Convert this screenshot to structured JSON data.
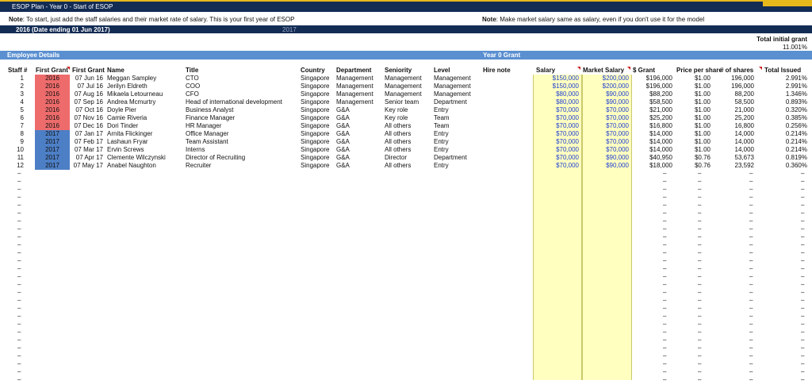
{
  "window": {
    "title": "ESOP Plan - Year 0 - Start of ESOP"
  },
  "notes": {
    "left_label": "Note",
    "left_text": ": To start, just add the staff salaries and their market rate of salary. This is your first year of ESOP",
    "right_label": "Note",
    "right_text": ": Make market salary same as salary, even if you don't use it for the model"
  },
  "year_bar": {
    "current": "2016 (Date ending 01 Jun 2017)",
    "next": "2017"
  },
  "summary": {
    "label": "Total initial grant",
    "value": "11.001%"
  },
  "section_bar": {
    "left": "Employee Details",
    "right": "Year 0 Grant"
  },
  "columns": [
    "Staff #",
    "First Grant",
    "First Grant",
    "Name",
    "Title",
    "Country",
    "Department",
    "Seniority",
    "Level",
    "Hire note",
    "Salary",
    "Market Salary",
    "$ Grant",
    "Price per share",
    "# of shares",
    "Total Issued"
  ],
  "rows": [
    {
      "n": "1",
      "year": "2016",
      "date": "07 Jun 16",
      "name": "Meggan Sampley",
      "title": "CTO",
      "country": "Singapore",
      "dept": "Management",
      "seniority": "Management",
      "level": "Management",
      "salary": "$150,000",
      "market": "$200,000",
      "grant": "$196,000",
      "price": "$1.00",
      "shares": "196,000",
      "issued": "2.991%"
    },
    {
      "n": "2",
      "year": "2016",
      "date": "07 Jul 16",
      "name": "Jerilyn Eldreth",
      "title": "COO",
      "country": "Singapore",
      "dept": "Management",
      "seniority": "Management",
      "level": "Management",
      "salary": "$150,000",
      "market": "$200,000",
      "grant": "$196,000",
      "price": "$1.00",
      "shares": "196,000",
      "issued": "2.991%"
    },
    {
      "n": "3",
      "year": "2016",
      "date": "07 Aug 16",
      "name": "Mikaela Letourneau",
      "title": "CFO",
      "country": "Singapore",
      "dept": "Management",
      "seniority": "Management",
      "level": "Management",
      "salary": "$80,000",
      "market": "$90,000",
      "grant": "$88,200",
      "price": "$1.00",
      "shares": "88,200",
      "issued": "1.346%"
    },
    {
      "n": "4",
      "year": "2016",
      "date": "07 Sep 16",
      "name": "Andrea Mcmurtry",
      "title": "Head of international development",
      "country": "Singapore",
      "dept": "Management",
      "seniority": "Senior team",
      "level": "Department",
      "salary": "$80,000",
      "market": "$90,000",
      "grant": "$58,500",
      "price": "$1.00",
      "shares": "58,500",
      "issued": "0.893%"
    },
    {
      "n": "5",
      "year": "2016",
      "date": "07 Oct 16",
      "name": "Doyle Pier",
      "title": "Business Analyst",
      "country": "Singapore",
      "dept": "G&A",
      "seniority": "Key role",
      "level": "Entry",
      "salary": "$70,000",
      "market": "$70,000",
      "grant": "$21,000",
      "price": "$1.00",
      "shares": "21,000",
      "issued": "0.320%"
    },
    {
      "n": "6",
      "year": "2016",
      "date": "07 Nov 16",
      "name": "Camie Riveria",
      "title": "Finance Manager",
      "country": "Singapore",
      "dept": "G&A",
      "seniority": "Key role",
      "level": "Team",
      "salary": "$70,000",
      "market": "$70,000",
      "grant": "$25,200",
      "price": "$1.00",
      "shares": "25,200",
      "issued": "0.385%"
    },
    {
      "n": "7",
      "year": "2016",
      "date": "07 Dec 16",
      "name": "Dori Tinder",
      "title": "HR Manager",
      "country": "Singapore",
      "dept": "G&A",
      "seniority": "All others",
      "level": "Team",
      "salary": "$70,000",
      "market": "$70,000",
      "grant": "$16,800",
      "price": "$1.00",
      "shares": "16,800",
      "issued": "0.256%"
    },
    {
      "n": "8",
      "year": "2017",
      "date": "07 Jan 17",
      "name": "Arnita Flickinger",
      "title": "Office Manager",
      "country": "Singapore",
      "dept": "G&A",
      "seniority": "All others",
      "level": "Entry",
      "salary": "$70,000",
      "market": "$70,000",
      "grant": "$14,000",
      "price": "$1.00",
      "shares": "14,000",
      "issued": "0.214%"
    },
    {
      "n": "9",
      "year": "2017",
      "date": "07 Feb 17",
      "name": "Lashaun Fryar",
      "title": "Team Assistant",
      "country": "Singapore",
      "dept": "G&A",
      "seniority": "All others",
      "level": "Entry",
      "salary": "$70,000",
      "market": "$70,000",
      "grant": "$14,000",
      "price": "$1.00",
      "shares": "14,000",
      "issued": "0.214%"
    },
    {
      "n": "10",
      "year": "2017",
      "date": "07 Mar 17",
      "name": "Ervin Screws",
      "title": "Interns",
      "country": "Singapore",
      "dept": "G&A",
      "seniority": "All others",
      "level": "Entry",
      "salary": "$70,000",
      "market": "$70,000",
      "grant": "$14,000",
      "price": "$1.00",
      "shares": "14,000",
      "issued": "0.214%"
    },
    {
      "n": "11",
      "year": "2017",
      "date": "07 Apr 17",
      "name": "Clemente Wilczynski",
      "title": "Director of Recruiting",
      "country": "Singapore",
      "dept": "G&A",
      "seniority": "Director",
      "level": "Department",
      "salary": "$70,000",
      "market": "$90,000",
      "grant": "$40,950",
      "price": "$0.76",
      "shares": "53,673",
      "issued": "0.819%"
    },
    {
      "n": "12",
      "year": "2017",
      "date": "07 May 17",
      "name": "Anabel Naughton",
      "title": "Recruiter",
      "country": "Singapore",
      "dept": "G&A",
      "seniority": "All others",
      "level": "Entry",
      "salary": "$70,000",
      "market": "$90,000",
      "grant": "$18,000",
      "price": "$0.76",
      "shares": "23,592",
      "issued": "0.360%"
    }
  ],
  "empty_marker": "–",
  "colors": {
    "year_2016": "#ee6b6b",
    "year_2017": "#4d7fc6",
    "input_cells": "#ffffc0",
    "header": "#132c54",
    "section": "#5a8fd0"
  }
}
